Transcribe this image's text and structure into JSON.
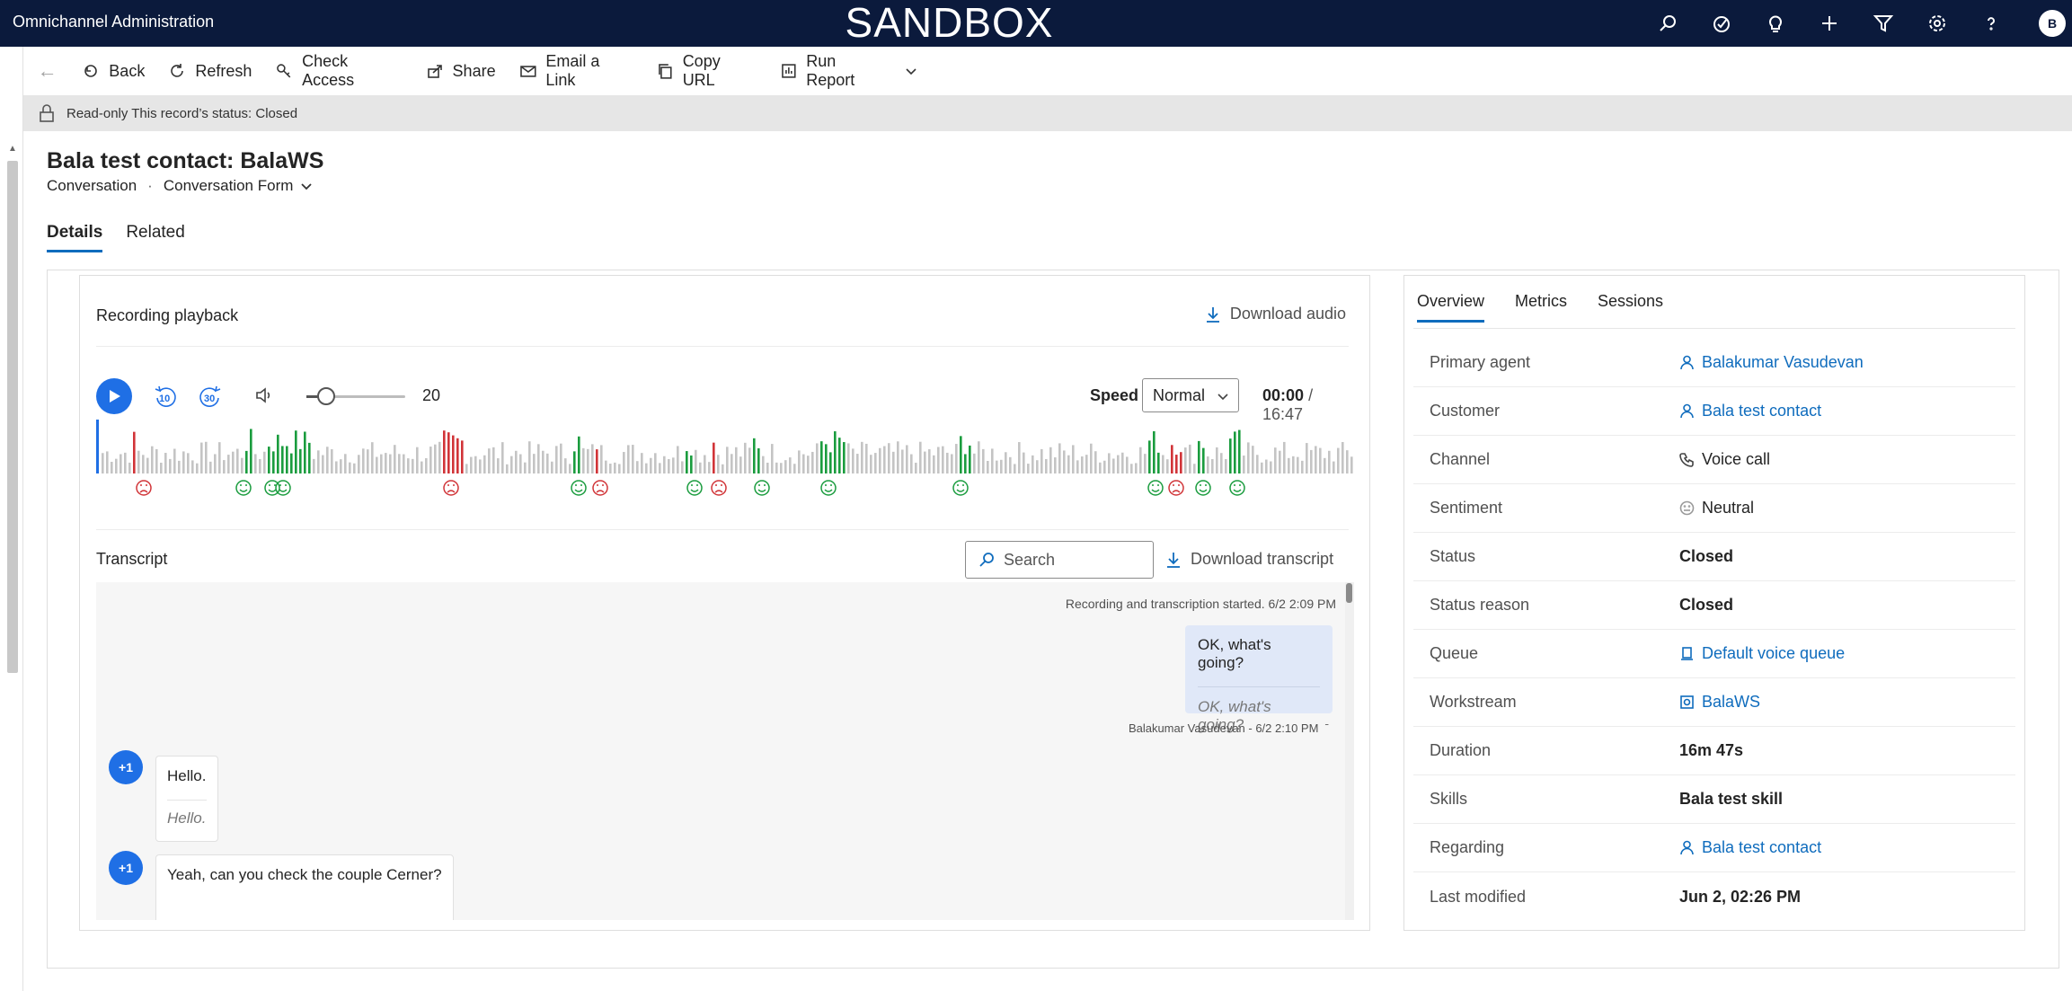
{
  "app_title": "Omnichannel Administration",
  "environment_banner": "SANDBOX",
  "top_icons": [
    "search-icon",
    "task-icon",
    "lightbulb-icon",
    "plus-icon",
    "filter-icon",
    "gear-icon",
    "help-icon"
  ],
  "user_avatar": "B",
  "commands": {
    "back": "Back",
    "refresh": "Refresh",
    "check_access": "Check Access",
    "share": "Share",
    "email_link": "Email a Link",
    "copy_url": "Copy URL",
    "run_report": "Run Report"
  },
  "readonly_text": "Read-only This record’s status: Closed",
  "record": {
    "title": "Bala test contact: BalaWS",
    "entity": "Conversation",
    "form": "Conversation Form"
  },
  "tabs": [
    "Details",
    "Related"
  ],
  "recording": {
    "title": "Recording playback",
    "download_audio": "Download audio",
    "skip_back": "10",
    "skip_fwd": "30",
    "volume": "20",
    "volume_level": 0.2,
    "speed_label": "Speed",
    "speed_value": "Normal",
    "time_current": "00:00",
    "time_total": "/ 16:47"
  },
  "colors": {
    "positive": "#1a9c3e",
    "negative": "#d13438",
    "neutral_bar": "#c4c4c4",
    "accent": "#1f6fe5",
    "topbar": "#0b1a3c"
  },
  "transcript": {
    "title": "Transcript",
    "search_placeholder": "Search",
    "download": "Download transcript",
    "system_message": "Recording and transcription started. 6/2 2:09 PM",
    "agent_message": {
      "text": "OK, what's going?",
      "translation": "OK, what's going?",
      "meta": "Balakumar Vasudevan - 6/2 2:10 PM"
    },
    "customer_messages": [
      {
        "avatar": "+1",
        "text": "Hello.",
        "translation": "Hello."
      },
      {
        "avatar": "+1",
        "text": "Yeah, can you check the couple Cerner?",
        "translation": ""
      }
    ]
  },
  "overview": {
    "tabs": [
      "Overview",
      "Metrics",
      "Sessions"
    ],
    "rows": [
      {
        "label": "Primary agent",
        "value": "Balakumar Vasudevan",
        "icon": "person-icon"
      },
      {
        "label": "Customer",
        "value": "Bala test contact",
        "icon": "person-icon"
      },
      {
        "label": "Channel",
        "value": "Voice call",
        "icon": "phone-icon"
      },
      {
        "label": "Sentiment",
        "value": "Neutral",
        "icon": "neutral-face-icon"
      },
      {
        "label": "Status",
        "value": "Closed"
      },
      {
        "label": "Status reason",
        "value": "Closed"
      },
      {
        "label": "Queue",
        "value": "Default voice queue",
        "icon": "queue-icon"
      },
      {
        "label": "Workstream",
        "value": "BalaWS",
        "icon": "workstream-icon"
      },
      {
        "label": "Duration",
        "value": "16m 47s"
      },
      {
        "label": "Skills",
        "value": "Bala test skill"
      },
      {
        "label": "Regarding",
        "value": "Bala test contact",
        "icon": "person-icon"
      },
      {
        "label": "Last modified",
        "value": "Jun 2, 02:26 PM"
      }
    ]
  }
}
